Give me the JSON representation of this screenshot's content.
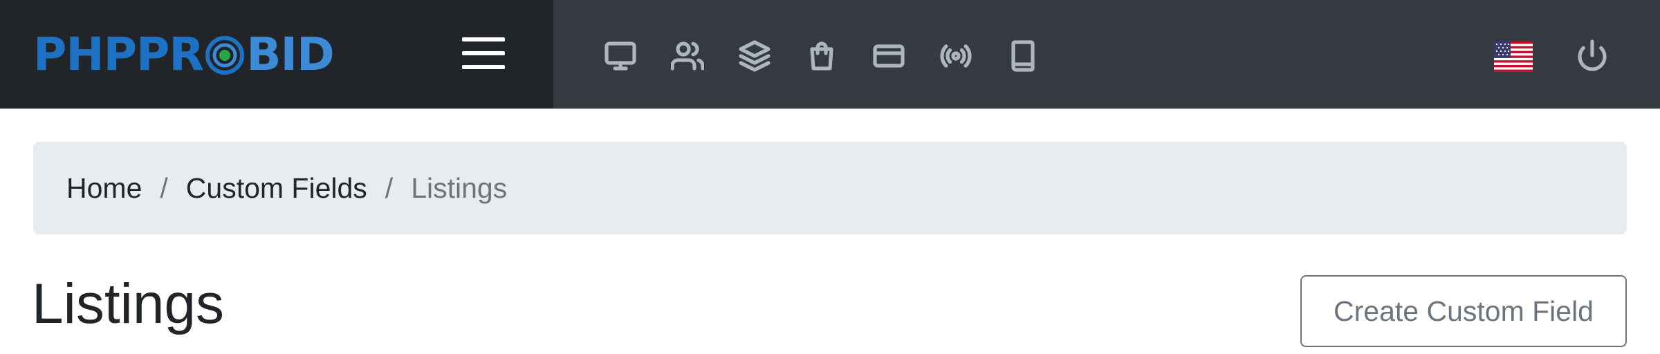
{
  "brand": {
    "logo_text_start": "PHPPR",
    "logo_text_end": "BID",
    "colors": {
      "primary": "#1d72c4",
      "secondary": "#3d8ad6",
      "ring_center": "#28a745"
    }
  },
  "topbar": {
    "menu_icon": "hamburger-icon",
    "nav_icons": [
      "monitor-icon",
      "users-icon",
      "layers-icon",
      "shopping-bag-icon",
      "credit-card-icon",
      "broadcast-icon",
      "book-icon"
    ],
    "language_icon": "us-flag-icon",
    "logout_icon": "power-icon",
    "colors": {
      "bar": "#343a40",
      "brand_area": "#212529",
      "icon": "#adb5bd"
    }
  },
  "breadcrumb": {
    "items": [
      "Home",
      "Custom Fields",
      "Listings"
    ],
    "separator": "/"
  },
  "page": {
    "title": "Listings",
    "create_button_label": "Create Custom Field"
  }
}
